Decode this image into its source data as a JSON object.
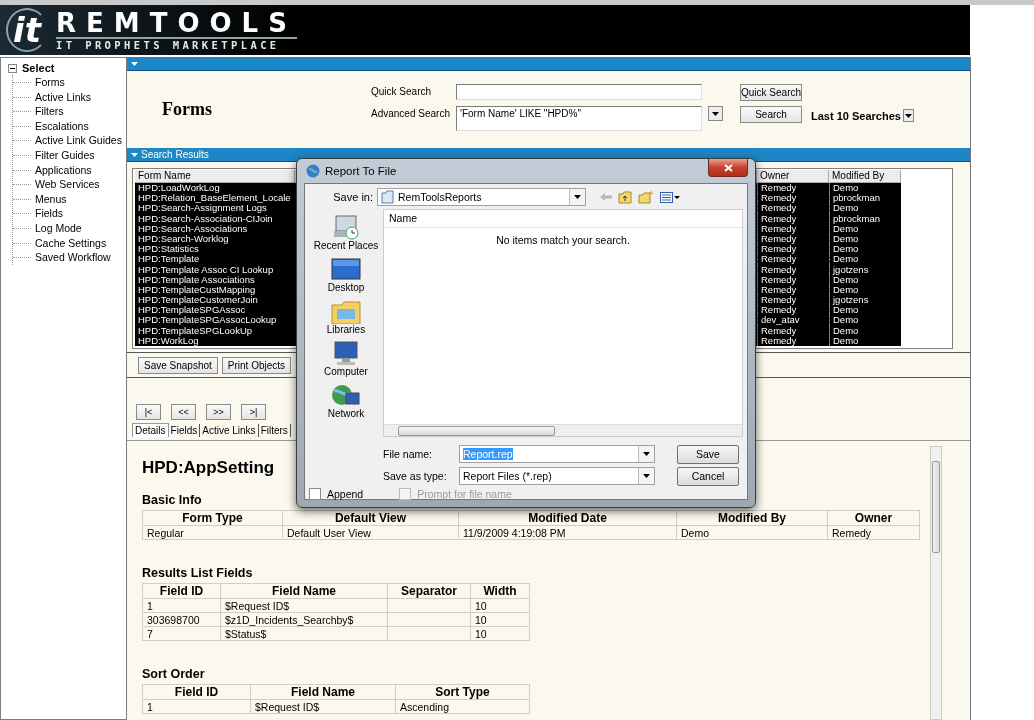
{
  "header": {
    "logo_mark": "it",
    "logo_title": "REMTOOLS",
    "logo_subtitle": "IT PROPHETS MARKETPLACE"
  },
  "sidebar": {
    "label": "Select",
    "expanded": true,
    "children": [
      {
        "label": "Forms"
      },
      {
        "label": "Active Links"
      },
      {
        "label": "Filters"
      },
      {
        "label": "Escalations"
      },
      {
        "label": "Active Link Guides"
      },
      {
        "label": "Filter Guides"
      },
      {
        "label": "Applications"
      },
      {
        "label": "Web Services"
      },
      {
        "label": "Menus"
      },
      {
        "label": "Fields"
      },
      {
        "label": "Log Mode"
      },
      {
        "label": "Cache Settings"
      },
      {
        "label": "Saved Workflow"
      }
    ]
  },
  "search_panel": {
    "heading": "Forms",
    "quick_search_label": "Quick Search",
    "quick_search_button": "Quick Search",
    "advanced_search_label": "Advanced Search",
    "advanced_search_value": "'Form Name' LIKE \"HPD%\"",
    "search_button": "Search",
    "recent_searches_label": "Last 10 Searches"
  },
  "search_results": {
    "title": "Search Results",
    "columns": [
      "Form Name",
      "Owner",
      "Modified By"
    ],
    "rows": [
      {
        "form_name": "HPD:LoadWorkLog",
        "owner": "Remedy",
        "modified_by": "Demo",
        "selected": true
      },
      {
        "form_name": "HPD:Relation_BaseElement_Locale",
        "owner": "Remedy",
        "modified_by": "pbrockman",
        "selected": true
      },
      {
        "form_name": "HPD:Search-Assignment Logs",
        "owner": "Remedy",
        "modified_by": "Demo",
        "selected": true
      },
      {
        "form_name": "HPD:Search-Association-CIJoin",
        "owner": "Remedy",
        "modified_by": "pbrockman",
        "selected": true
      },
      {
        "form_name": "HPD:Search-Associations",
        "owner": "Remedy",
        "modified_by": "Demo",
        "selected": true
      },
      {
        "form_name": "HPD:Search-Worklog",
        "owner": "Remedy",
        "modified_by": "Demo",
        "selected": true
      },
      {
        "form_name": "HPD:Statistics",
        "owner": "Remedy",
        "modified_by": "Demo",
        "selected": true
      },
      {
        "form_name": "HPD:Template",
        "owner": "Remedy",
        "modified_by": "Demo",
        "selected": true
      },
      {
        "form_name": "HPD:Template Assoc CI Lookup",
        "owner": "Remedy",
        "modified_by": "jgotzens",
        "selected": true
      },
      {
        "form_name": "HPD:Template Associations",
        "owner": "Remedy",
        "modified_by": "Demo",
        "selected": true
      },
      {
        "form_name": "HPD:TemplateCustMapping",
        "owner": "Remedy",
        "modified_by": "Demo",
        "selected": true
      },
      {
        "form_name": "HPD:TemplateCustomerJoin",
        "owner": "Remedy",
        "modified_by": "jgotzens",
        "selected": true
      },
      {
        "form_name": "HPD:TemplateSPGAssoc",
        "owner": "Remedy",
        "modified_by": "Demo",
        "selected": true
      },
      {
        "form_name": "HPD:TemplateSPGAssocLookup",
        "owner": "dev_atav",
        "modified_by": "Demo",
        "selected": true
      },
      {
        "form_name": "HPD:TemplateSPGLookUp",
        "owner": "Remedy",
        "modified_by": "Demo",
        "selected": true
      },
      {
        "form_name": "HPD:WorkLog",
        "owner": "Remedy",
        "modified_by": "Demo",
        "selected": true
      }
    ],
    "buttons": [
      "Save Snapshot",
      "Print Objects"
    ]
  },
  "navigation": [
    "|<",
    "<<",
    ">>",
    ">|"
  ],
  "detail_tabs": [
    {
      "label": "Details",
      "selected": true
    },
    {
      "label": "Fields",
      "selected": false
    },
    {
      "label": "Active Links",
      "selected": false
    },
    {
      "label": "Filters",
      "selected": false
    }
  ],
  "details": {
    "title": "HPD:AppSetting",
    "sections": [
      {
        "heading": "Basic Info",
        "columns": [
          "Form Type",
          "Default View",
          "Modified Date",
          "Modified By",
          "Owner"
        ],
        "rows": [
          [
            "Regular",
            "Default User View",
            "11/9/2009 4:19:08 PM",
            "Demo",
            "Remedy"
          ]
        ]
      },
      {
        "heading": "Results List Fields",
        "columns": [
          "Field ID",
          "Field Name",
          "Separator",
          "Width"
        ],
        "rows": [
          [
            "1",
            "$Request ID$",
            null,
            "10"
          ],
          [
            "303698700",
            "$z1D_Incidents_Searchby$",
            null,
            "10"
          ],
          [
            "7",
            "$Status$",
            null,
            "10"
          ]
        ]
      },
      {
        "heading": "Sort Order",
        "columns": [
          "Field ID",
          "Field Name",
          "Sort Type"
        ],
        "rows": [
          [
            "1",
            "$Request ID$",
            "Ascending"
          ]
        ]
      }
    ]
  },
  "dialog": {
    "title": "Report To File",
    "save_in_label": "Save in:",
    "save_in_value": "RemToolsReports",
    "places": [
      {
        "label": "Recent Places",
        "kind": "recent"
      },
      {
        "label": "Desktop",
        "kind": "desktop"
      },
      {
        "label": "Libraries",
        "kind": "libraries"
      },
      {
        "label": "Computer",
        "kind": "computer"
      },
      {
        "label": "Network",
        "kind": "network"
      }
    ],
    "file_column": "Name",
    "empty_message": "No items match your search.",
    "file_name": {
      "label": "File name:",
      "value": "Report.rep",
      "highlighted": true
    },
    "save_type": {
      "label": "Save as type:",
      "value": "Report Files (*.rep)"
    },
    "buttons": [
      "Save",
      "Cancel"
    ],
    "options": [
      {
        "label": "Append",
        "checked": false,
        "disabled": false
      },
      {
        "label": "Prompt for file name",
        "checked": false,
        "disabled": true
      }
    ]
  }
}
